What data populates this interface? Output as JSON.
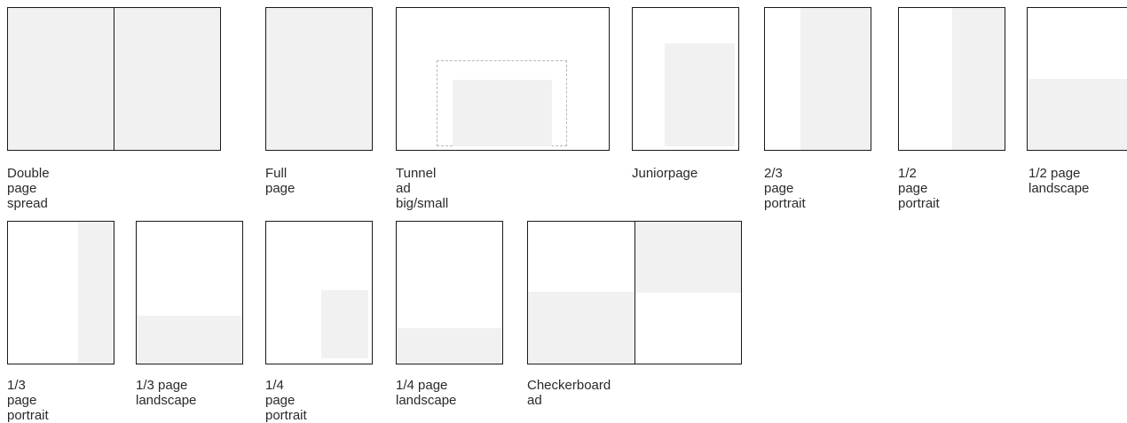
{
  "formats": [
    {
      "id": "double-page-spread",
      "label": "Double page spread"
    },
    {
      "id": "full-page",
      "label": "Full page"
    },
    {
      "id": "tunnel-ad",
      "label": "Tunnel ad big/small"
    },
    {
      "id": "juniorpage",
      "label": "Juniorpage"
    },
    {
      "id": "two-thirds-portrait",
      "label": "2/3 page\nportrait"
    },
    {
      "id": "half-portrait",
      "label": "1/2 page\nportrait"
    },
    {
      "id": "half-landscape",
      "label": "1/2 page\nlandscape"
    },
    {
      "id": "third-portrait",
      "label": "1/3 page\nportrait"
    },
    {
      "id": "third-landscape",
      "label": "1/3 page\nlandscape"
    },
    {
      "id": "quarter-portrait",
      "label": "1/4 page\nportrait"
    },
    {
      "id": "quarter-landscape",
      "label": "1/4 page\nlandscape"
    },
    {
      "id": "checkerboard-ad",
      "label": "Checkerboard ad"
    }
  ]
}
